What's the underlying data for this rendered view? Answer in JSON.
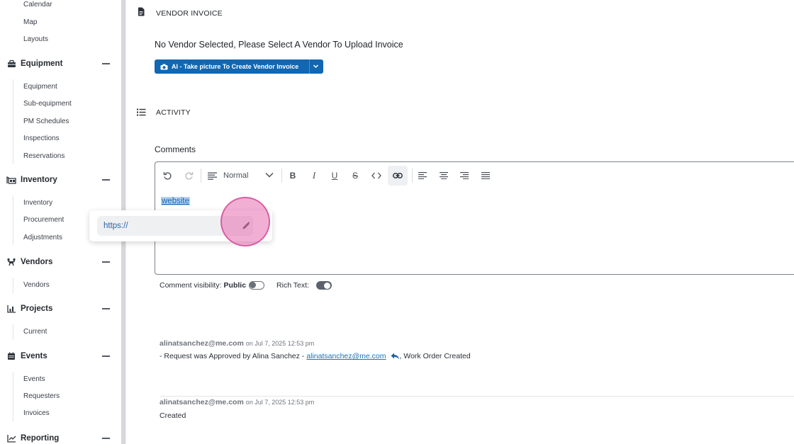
{
  "sidebar": {
    "top_items": [
      "Calendar",
      "Map",
      "Layouts"
    ],
    "groups": [
      {
        "label": "Equipment",
        "items": [
          "Equipment",
          "Sub-equipment",
          "PM Schedules",
          "Inspections",
          "Reservations"
        ]
      },
      {
        "label": "Inventory",
        "items": [
          "Inventory",
          "Procurement",
          "Adjustments"
        ]
      },
      {
        "label": "Vendors",
        "items": [
          "Vendors"
        ]
      },
      {
        "label": "Projects",
        "items": [
          "Current"
        ]
      },
      {
        "label": "Events",
        "items": [
          "Events",
          "Requesters",
          "Invoices"
        ]
      },
      {
        "label": "Reporting",
        "items": []
      }
    ]
  },
  "vendor_invoice": {
    "title": "VENDOR INVOICE",
    "notice": "No Vendor Selected, Please Select A Vendor To Upload Invoice",
    "ai_button": "AI - Take picture To Create Vendor Invoice"
  },
  "activity": {
    "title": "ACTIVITY",
    "comments_label": "Comments",
    "editor": {
      "format_value": "Normal",
      "selected_text": "website"
    },
    "link_popover": {
      "url_value": "https://"
    },
    "visibility_label": "Comment visibility:",
    "visibility_value": "Public",
    "rich_text_label": "Rich Text:",
    "entries": [
      {
        "author": "alinatsanchez@me.com",
        "when": "on Jul 7, 2025 12:53 pm",
        "text_prefix": "- Request was Approved by Alina Sanchez -",
        "link": "alinatsanchez@me.com",
        "text_suffix": ", Work Order Created"
      },
      {
        "author": "alinatsanchez@me.com",
        "when": "on Jul 7, 2025 12:53 pm",
        "text": "Created"
      }
    ]
  },
  "colors": {
    "primary_button": "#1167b1",
    "click_highlight": "#e86eb0",
    "selection": "#b8d4f4"
  }
}
